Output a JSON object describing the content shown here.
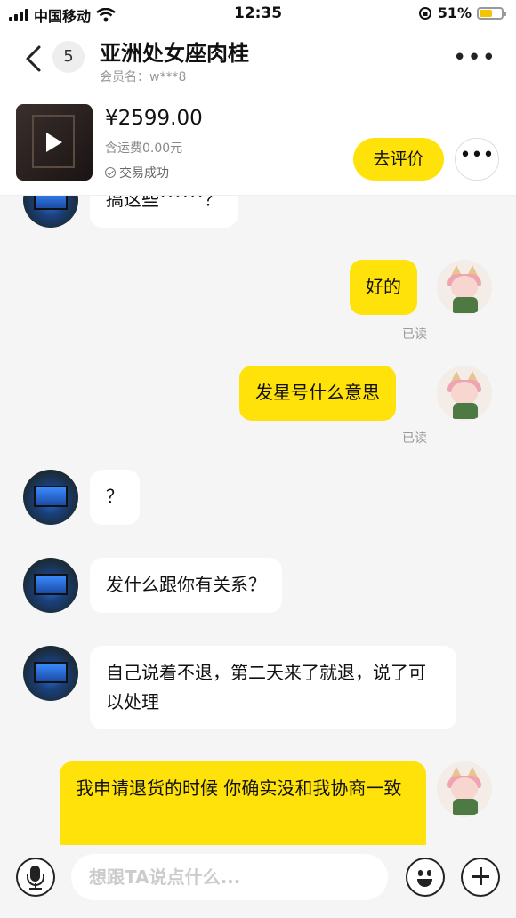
{
  "status_bar": {
    "carrier": "中国移动",
    "time": "12:35",
    "battery_percent": "51%",
    "battery_level": 0.51,
    "battery_color": "#f5c400"
  },
  "header": {
    "unread_count": "5",
    "title": "亚洲处女座肉桂",
    "member_label": "会员名：w***8"
  },
  "product": {
    "price": "¥2599.00",
    "shipping": "含运费0.00元",
    "status": "交易成功",
    "review_button": "去评价"
  },
  "messages": [
    {
      "side": "left",
      "text": "搞这些^^^？"
    },
    {
      "side": "right",
      "text": "好的",
      "read": "已读"
    },
    {
      "side": "right",
      "text": "发星号什么意思",
      "read": "已读"
    },
    {
      "side": "left",
      "text": "？"
    },
    {
      "side": "left",
      "text": "发什么跟你有关系？"
    },
    {
      "side": "left",
      "text": "自己说着不退，第二天来了就退，说了可以处理"
    },
    {
      "side": "right",
      "text": "我申请退货的时候 你确实没和我协商一致"
    }
  ],
  "input": {
    "placeholder": "想跟TA说点什么..."
  },
  "colors": {
    "accent": "#ffe20a",
    "background": "#f5f5f5"
  }
}
